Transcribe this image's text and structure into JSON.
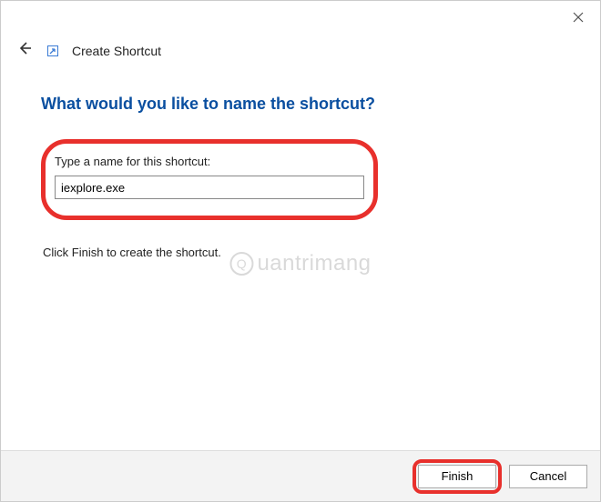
{
  "window": {
    "wizard_title": "Create Shortcut"
  },
  "main": {
    "question": "What would you like to name the shortcut?",
    "input_label": "Type a name for this shortcut:",
    "input_value": "iexplore.exe",
    "instruction": "Click Finish to create the shortcut."
  },
  "buttons": {
    "finish": "Finish",
    "cancel": "Cancel"
  },
  "watermark": {
    "text": "uantrimang"
  }
}
